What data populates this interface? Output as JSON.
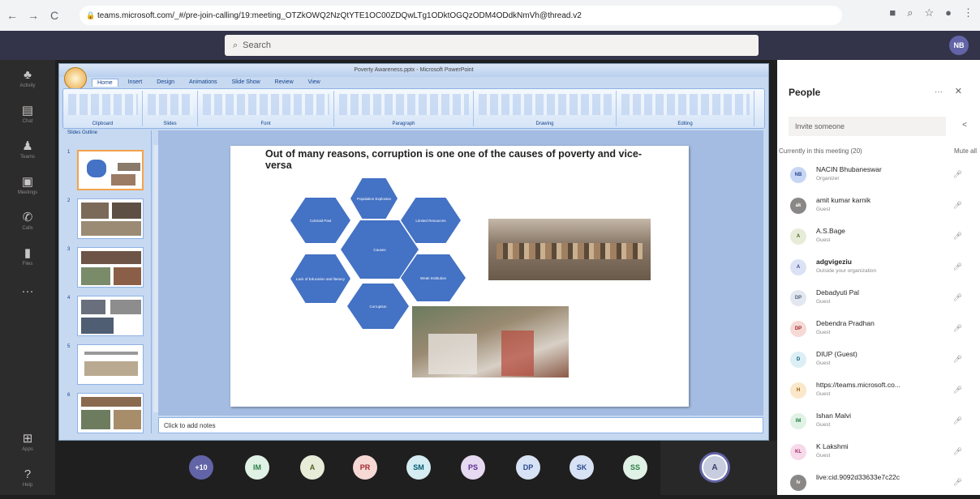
{
  "browser": {
    "url": "teams.microsoft.com/_#/pre-join-calling/19:meeting_OTZkOWQ2NzQtYTE1OC00ZDQwLTg1ODktOGQzODM4ODdkNmVh@thread.v2",
    "back": "←",
    "forward": "→",
    "reload": "C"
  },
  "teams": {
    "search_placeholder": "Search",
    "me_initials": "NB"
  },
  "rail": [
    {
      "icon": "bell-icon",
      "glyph": "♣",
      "label": "Activity"
    },
    {
      "icon": "chat-icon",
      "glyph": "▤",
      "label": "Chat"
    },
    {
      "icon": "teams-icon",
      "glyph": "♟",
      "label": "Teams"
    },
    {
      "icon": "calendar-icon",
      "glyph": "▣",
      "label": "Meetings"
    },
    {
      "icon": "calls-icon",
      "glyph": "✆",
      "label": "Calls"
    },
    {
      "icon": "files-icon",
      "glyph": "▮",
      "label": "Files"
    },
    {
      "icon": "more-icon",
      "glyph": "···",
      "label": ""
    }
  ],
  "rail_bottom": [
    {
      "icon": "apps-icon",
      "glyph": "⊞",
      "label": "Apps"
    },
    {
      "icon": "help-icon",
      "glyph": "?",
      "label": "Help"
    }
  ],
  "ppt": {
    "title": "Poverty Awareness.pptx - Microsoft PowerPoint",
    "tabs": [
      "Home",
      "Insert",
      "Design",
      "Animations",
      "Slide Show",
      "Review",
      "View"
    ],
    "groups": [
      "Clipboard",
      "Slides",
      "Font",
      "Paragraph",
      "Drawing",
      "Editing"
    ],
    "thumb_tabs": "Slides  Outline",
    "notes_placeholder": "Click to add notes",
    "slide_title": "Out of many reasons, corruption is one one of the  causes of poverty and vice-versa",
    "hexagons": [
      "Population Explosion",
      "Colonial Past",
      "Limited Resources",
      "Causes",
      "Lack of Education and literacy",
      "Weak Institution",
      "Corruption"
    ]
  },
  "people": {
    "title": "People",
    "more": "···",
    "close": "✕",
    "invite_placeholder": "Invite someone",
    "current_label": "Currently in this meeting (20)",
    "mute_all": "Mute all",
    "list": [
      {
        "initials": "NB",
        "name": "NACIN Bhubaneswar",
        "role": "Organizer",
        "bold": false,
        "bg": "#c7d6f5",
        "fg": "#2b4a8c"
      },
      {
        "initials": "ak",
        "name": "amit kumar karnik",
        "role": "Guest",
        "bold": false,
        "bg": "#8a8886",
        "fg": "#ffffff"
      },
      {
        "initials": "A",
        "name": "A.S.Bage",
        "role": "Guest",
        "bold": false,
        "bg": "#e7ecd8",
        "fg": "#4f6228"
      },
      {
        "initials": "A",
        "name": "adgvigeziu",
        "role": "Outside your organization",
        "bold": true,
        "bg": "#dce2f5",
        "fg": "#3c4a8c"
      },
      {
        "initials": "DP",
        "name": "Debadyuti Pal",
        "role": "Guest",
        "bold": false,
        "bg": "#e3e7ef",
        "fg": "#51607a"
      },
      {
        "initials": "DP",
        "name": "Debendra Pradhan",
        "role": "Guest",
        "bold": false,
        "bg": "#f6d9d5",
        "fg": "#a4262c"
      },
      {
        "initials": "D",
        "name": "DIUP (Guest)",
        "role": "Guest",
        "bold": false,
        "bg": "#dbeff5",
        "fg": "#005b70"
      },
      {
        "initials": "H",
        "name": "https://teams.microsoft.co...",
        "role": "Guest",
        "bold": false,
        "bg": "#fbe7c9",
        "fg": "#8a5a00"
      },
      {
        "initials": "IM",
        "name": "Ishan Malvi",
        "role": "Guest",
        "bold": false,
        "bg": "#dff2e5",
        "fg": "#2e7d45"
      },
      {
        "initials": "KL",
        "name": "K Lakshmi",
        "role": "Guest",
        "bold": false,
        "bg": "#f7d9e9",
        "fg": "#9b2f6a"
      },
      {
        "initials": "lv",
        "name": "live:cid.9092d33633e7c22c",
        "role": "",
        "bold": false,
        "bg": "#8a8886",
        "fg": "#ffffff"
      }
    ]
  },
  "bottom": [
    {
      "initials": "+10",
      "bg": "#6264a7",
      "fg": "#ffffff"
    },
    {
      "initials": "IM",
      "bg": "#dff2e5",
      "fg": "#2e7d45"
    },
    {
      "initials": "A",
      "bg": "#e7ecd8",
      "fg": "#4f6228"
    },
    {
      "initials": "PR",
      "bg": "#f6d9d5",
      "fg": "#a4262c"
    },
    {
      "initials": "SM",
      "bg": "#d4ecf2",
      "fg": "#005b70"
    },
    {
      "initials": "PS",
      "bg": "#e6d9f2",
      "fg": "#5c2e91"
    },
    {
      "initials": "DP",
      "bg": "#d7e2f5",
      "fg": "#2b4a8c"
    },
    {
      "initials": "SK",
      "bg": "#d7e2f5",
      "fg": "#2b4a8c"
    },
    {
      "initials": "SS",
      "bg": "#dff2e5",
      "fg": "#2e7d45"
    }
  ],
  "self": {
    "initials": "A"
  }
}
